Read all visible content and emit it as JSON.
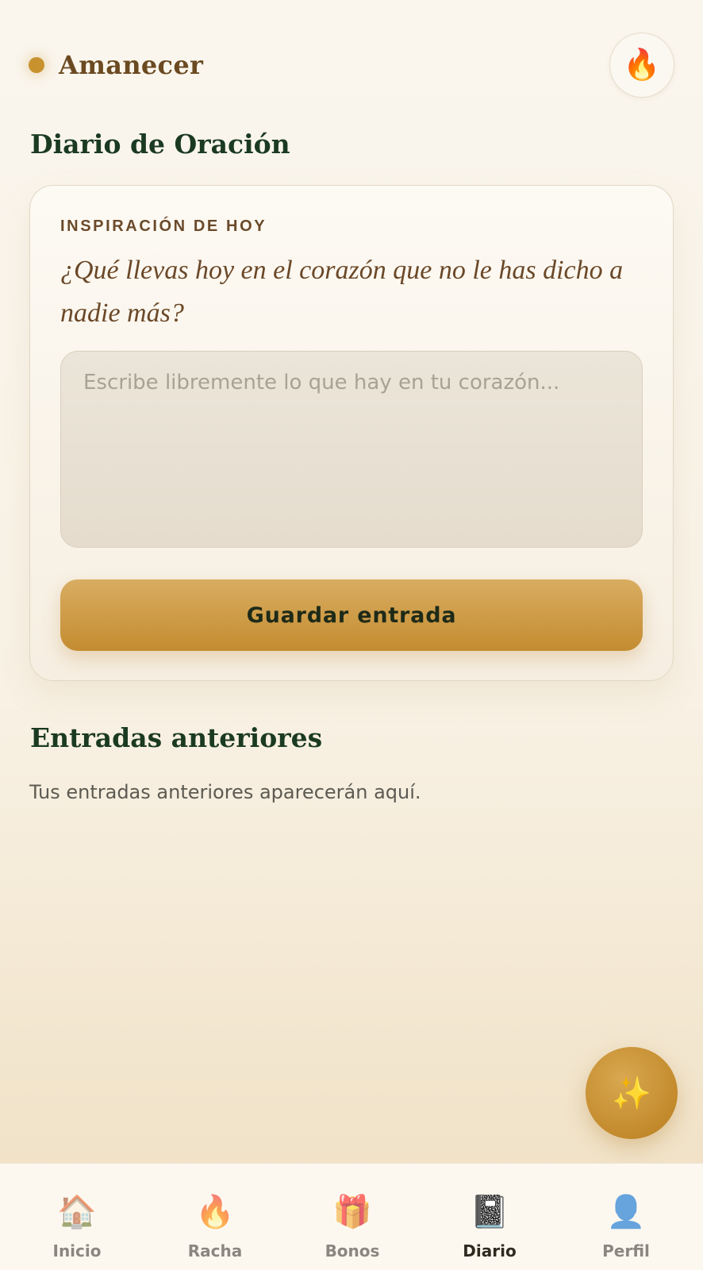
{
  "header": {
    "app_name": "Amanecer",
    "streak_icon": "fire-icon",
    "streak_glyph": "🔥"
  },
  "page": {
    "title": "Diario de Oración"
  },
  "inspiration": {
    "label": "INSPIRACIÓN DE HOY",
    "prompt": "¿Qué llevas hoy en el corazón que no le has dicho a nadie más?"
  },
  "entry": {
    "value": "",
    "placeholder": "Escribe libremente lo que hay en tu corazón..."
  },
  "save_button": {
    "label": "Guardar entrada"
  },
  "previous_entries": {
    "title": "Entradas anteriores",
    "empty_text": "Tus entradas anteriores aparecerán aquí."
  },
  "fab": {
    "icon": "sparkles-icon",
    "glyph": "✨"
  },
  "nav": {
    "items": [
      {
        "label": "Inicio",
        "icon": "house-icon",
        "glyph": "🏠",
        "active": false
      },
      {
        "label": "Racha",
        "icon": "fire-icon",
        "glyph": "🔥",
        "active": false
      },
      {
        "label": "Bonos",
        "icon": "gift-icon",
        "glyph": "🎁",
        "active": false
      },
      {
        "label": "Diario",
        "icon": "notebook-icon",
        "glyph": "📓",
        "active": true
      },
      {
        "label": "Perfil",
        "icon": "user-icon",
        "glyph": "👤",
        "active": false
      }
    ]
  },
  "colors": {
    "accent": "#c8922e",
    "heading": "#1b3a22",
    "brand_text": "#6b4a22"
  }
}
